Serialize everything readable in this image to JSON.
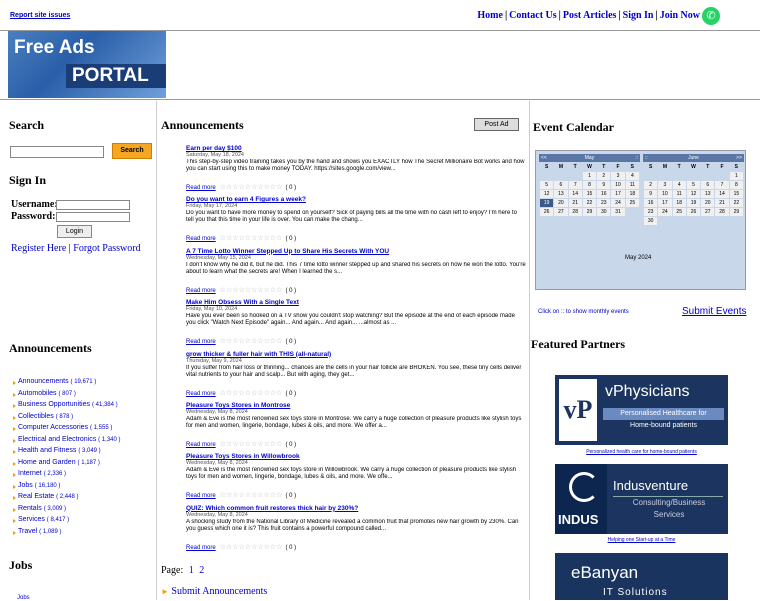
{
  "top": {
    "report": "Report site issues",
    "nav": [
      "Home",
      "Contact Us",
      "Post Articles",
      "Sign In",
      "Join Now"
    ]
  },
  "logo": {
    "line1": "Free Ads",
    "line2": "PORTAL"
  },
  "left": {
    "search_title": "Search",
    "search_button": "Search",
    "signin_title": "Sign In",
    "username_label": "Username:",
    "password_label": "Password:",
    "login_button": "Login",
    "register": "Register Here",
    "sep": "|",
    "forgot": "Forgot Password",
    "announcements_title": "Announcements",
    "categories": [
      {
        "name": "Announcements",
        "count": "( 19,671 )"
      },
      {
        "name": "Automobiles",
        "count": "( 807 )"
      },
      {
        "name": "Business Opportunities",
        "count": "( 41,384 )"
      },
      {
        "name": "Collectibles",
        "count": "( 878 )"
      },
      {
        "name": "Computer Accessories",
        "count": "( 1,555 )"
      },
      {
        "name": "Electrical and Electronics",
        "count": "( 1,340 )"
      },
      {
        "name": "Health and Fitness",
        "count": "( 3,049 )"
      },
      {
        "name": "Home and Garden",
        "count": "( 1,187 )"
      },
      {
        "name": "Internet",
        "count": "( 2,336 )"
      },
      {
        "name": "Jobs",
        "count": "( 16,180 )"
      },
      {
        "name": "Real Estate",
        "count": "( 2,448 )"
      },
      {
        "name": "Rentals",
        "count": "( 3,009 )"
      },
      {
        "name": "Services",
        "count": "( 8,417 )"
      },
      {
        "name": "Travel",
        "count": "( 1,089 )"
      }
    ],
    "jobs_title": "Jobs",
    "jobs_sub": "Jobs"
  },
  "center": {
    "title": "Announcements",
    "post_ad": "Post Ad",
    "items": [
      {
        "title": "Earn per day $100",
        "date": "Saturday, May 18, 2024",
        "body": "This step-by-step video training takes you by the hand and shows you EXACTLY how The Secret Millionaire Bot works and how you can start using this to make money TODAY. https://sites.google.com/view...",
        "more": "Read more",
        "count": "( 0 )"
      },
      {
        "title": "Do you want to earn 4 Figures a week?",
        "date": "Friday, May 17, 2024",
        "body": "Do you want to have more money to spend on yourself? Sick of paying bills all the time with no cash left to enjoy? I'm here to tell you that this time in your life is over. You can make the chang...",
        "more": "Read more",
        "count": "( 0 )"
      },
      {
        "title": "A 7 Time Lotto Winner Stepped Up to Share His Secrets With YOU",
        "date": "Wednesday, May 15, 2024",
        "body": "I don't know why he did it, but he did. This 7 time lotto winner stepped up and shared his secrets on how he won the lotto. You're about to learn what the secrets are! When I learned the s...",
        "more": "Read more",
        "count": "( 0 )"
      },
      {
        "title": "Make Him Obsess With a Single Text",
        "date": "Friday, May 10, 2024",
        "body": "Have you ever been so hooked on a TV show you couldn't stop watching? But the episode at the end of each episode made you click \"Watch Next Episode\" again... And again... And again... ...almost as ...",
        "more": "Read more",
        "count": "( 0 )"
      },
      {
        "title": "grow thicker & fuller hair with THIS (all-natural)",
        "date": "Thursday, May 9, 2024",
        "body": "If you suffer from hair loss or thinning... chances are the cells in your hair follicle are BROKEN. You see, these tiny cells deliver vital nutrients to your hair and scalp... But with aging, they get...",
        "more": "Read more",
        "count": "( 0 )"
      },
      {
        "title": "Pleasure Toys Stores in Montrose",
        "date": "Wednesday, May 8, 2024",
        "body": "Adam & Eve is the most renowned sex toys store in Montrose. We carry a huge collection of pleasure products like stylish toys for men and women, lingerie, bondage, lubes & oils, and more. We offer a...",
        "more": "Read more",
        "count": "( 0 )"
      },
      {
        "title": "Pleasure Toys Stores in Willowbrook",
        "date": "Wednesday, May 8, 2024",
        "body": "Adam & Eve is the most renowned sex toys store in Willowbrook. We carry a huge collection of pleasure products like stylish toys for men and women, lingerie, bondage, lubes & oils, and more. We offe...",
        "more": "Read more",
        "count": "( 0 )"
      },
      {
        "title": "QUIZ: Which common fruit restores thick hair by 230%?",
        "date": "Wednesday, May 8, 2024",
        "body": "A shocking study from the National Library of Medicine revealed a common fruit that promotes new hair growth by 230%. Can you guess which one it is? This fruit contains a powerful compound called...",
        "more": "Read more",
        "count": "( 0 )"
      }
    ],
    "page_label": "Page:",
    "pages": [
      "1",
      "2"
    ],
    "submit": "Submit Announcements"
  },
  "right": {
    "event_title": "Event Calendar",
    "cal_title": "May 2024",
    "click_on": "Click on :: to show monthly events",
    "submit_events": "Submit Events",
    "featured_title": "Featured Partners",
    "months": [
      {
        "name": "May",
        "prev": "<<",
        "next": "::",
        "weeks": [
          [
            "",
            "",
            "",
            "1",
            "2",
            "3",
            "4"
          ],
          [
            "5",
            "6",
            "7",
            "8",
            "9",
            "10",
            "11"
          ],
          [
            "12",
            "13",
            "14",
            "15",
            "16",
            "17",
            "18"
          ],
          [
            "19",
            "20",
            "21",
            "22",
            "23",
            "24",
            "25"
          ],
          [
            "26",
            "27",
            "28",
            "29",
            "30",
            "31",
            ""
          ]
        ],
        "selected": "19"
      },
      {
        "name": "June",
        "prev": "::",
        "next": ">>",
        "weeks": [
          [
            "",
            "",
            "",
            "",
            "",
            "",
            "1"
          ],
          [
            "2",
            "3",
            "4",
            "5",
            "6",
            "7",
            "8"
          ],
          [
            "9",
            "10",
            "11",
            "12",
            "13",
            "14",
            "15"
          ],
          [
            "16",
            "17",
            "18",
            "19",
            "20",
            "21",
            "22"
          ],
          [
            "23",
            "24",
            "25",
            "26",
            "27",
            "28",
            "29"
          ],
          [
            "30",
            "",
            "",
            "",
            "",
            "",
            ""
          ]
        ],
        "selected": ""
      }
    ],
    "day_heads": [
      "S",
      "M",
      "T",
      "W",
      "T",
      "F",
      "S"
    ],
    "partners": [
      {
        "logo": "vP",
        "name": "vPhysicians",
        "tag1": "Personalised Healthcare for",
        "tag2": "Home-bound patients",
        "caption": "Personalized health care for home-bound patients"
      },
      {
        "logo": "INDUS",
        "name": "Indusventure",
        "tag1": "Consulting/Business",
        "tag2": "Services",
        "caption": "Helping one Start-up at a Time"
      },
      {
        "logo": "",
        "name": "eBanyan",
        "tag1": "IT Solutions",
        "tag2": "",
        "caption": ""
      }
    ]
  }
}
